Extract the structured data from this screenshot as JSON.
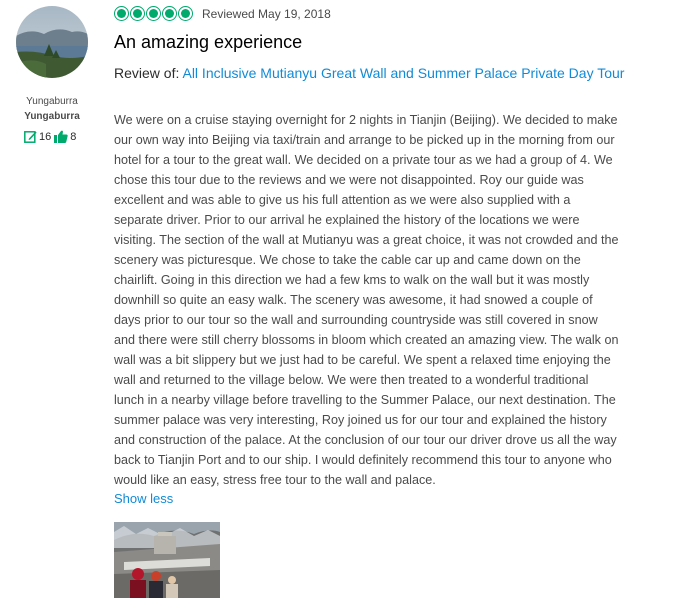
{
  "reviewer": {
    "location": "Yungaburra",
    "name": "Yungaburra",
    "contributions": "16",
    "helpful_votes": "8"
  },
  "review": {
    "rating": 5,
    "rating_max": 5,
    "date": "Reviewed May 19, 2018",
    "title": "An amazing experience",
    "review_of_label": "Review of:",
    "tour_link": "All Inclusive Mutianyu Great Wall and Summer Palace Private Day Tour",
    "text": "We were on a cruise staying overnight for 2 nights in Tianjin (Beijing). We decided to make\nour own way into Beijing via taxi/train and arrange to be picked up in the morning from our\nhotel for a tour to the great wall. We decided on a private tour as we had a group of 4. We\nchose this tour due to the reviews and we were not disappointed. Roy our guide was\nexcellent and was able to give us his full attention as we were also supplied with a\nseparate driver. Prior to our arrival he explained the history of the locations we were\nvisiting. The section of the wall at Mutianyu was a great choice, it was not crowded and the\nscenery was picturesque. We chose to take the cable car up and came down on the\nchairlift. Going in this direction we had a few kms to walk on the wall but it was mostly\ndownhill so quite an easy walk. The scenery was awesome, it had snowed a couple of\ndays prior to our tour so the wall and surrounding countryside was still covered in snow\nand there were still cherry blossoms in bloom which created an amazing view. The walk on\nwall was a bit slippery but we just had to be careful. We spent a relaxed time enjoying the\nwall and returned to the village below. We were then treated to a wonderful traditional\nlunch in a nearby village before travelling to the Summer Palace, our next destination. The\nsummer palace was very interesting, Roy joined us for our tour and explained the history\nand construction of the palace. At the conclusion of our tour our driver drove us all the way\nback to Tianjin Port and to our ship. I would definitely recommend this tour to anyone who\nwould like an easy, stress free tour to the wall and palace.",
    "show_less": "Show less"
  },
  "colors": {
    "rating_green": "#00aa6c",
    "link_blue": "#118bd6",
    "body_text": "#4a4a4a"
  },
  "icons": {
    "contributions": "pencil-box-icon",
    "helpful": "thumbs-up-icon"
  }
}
